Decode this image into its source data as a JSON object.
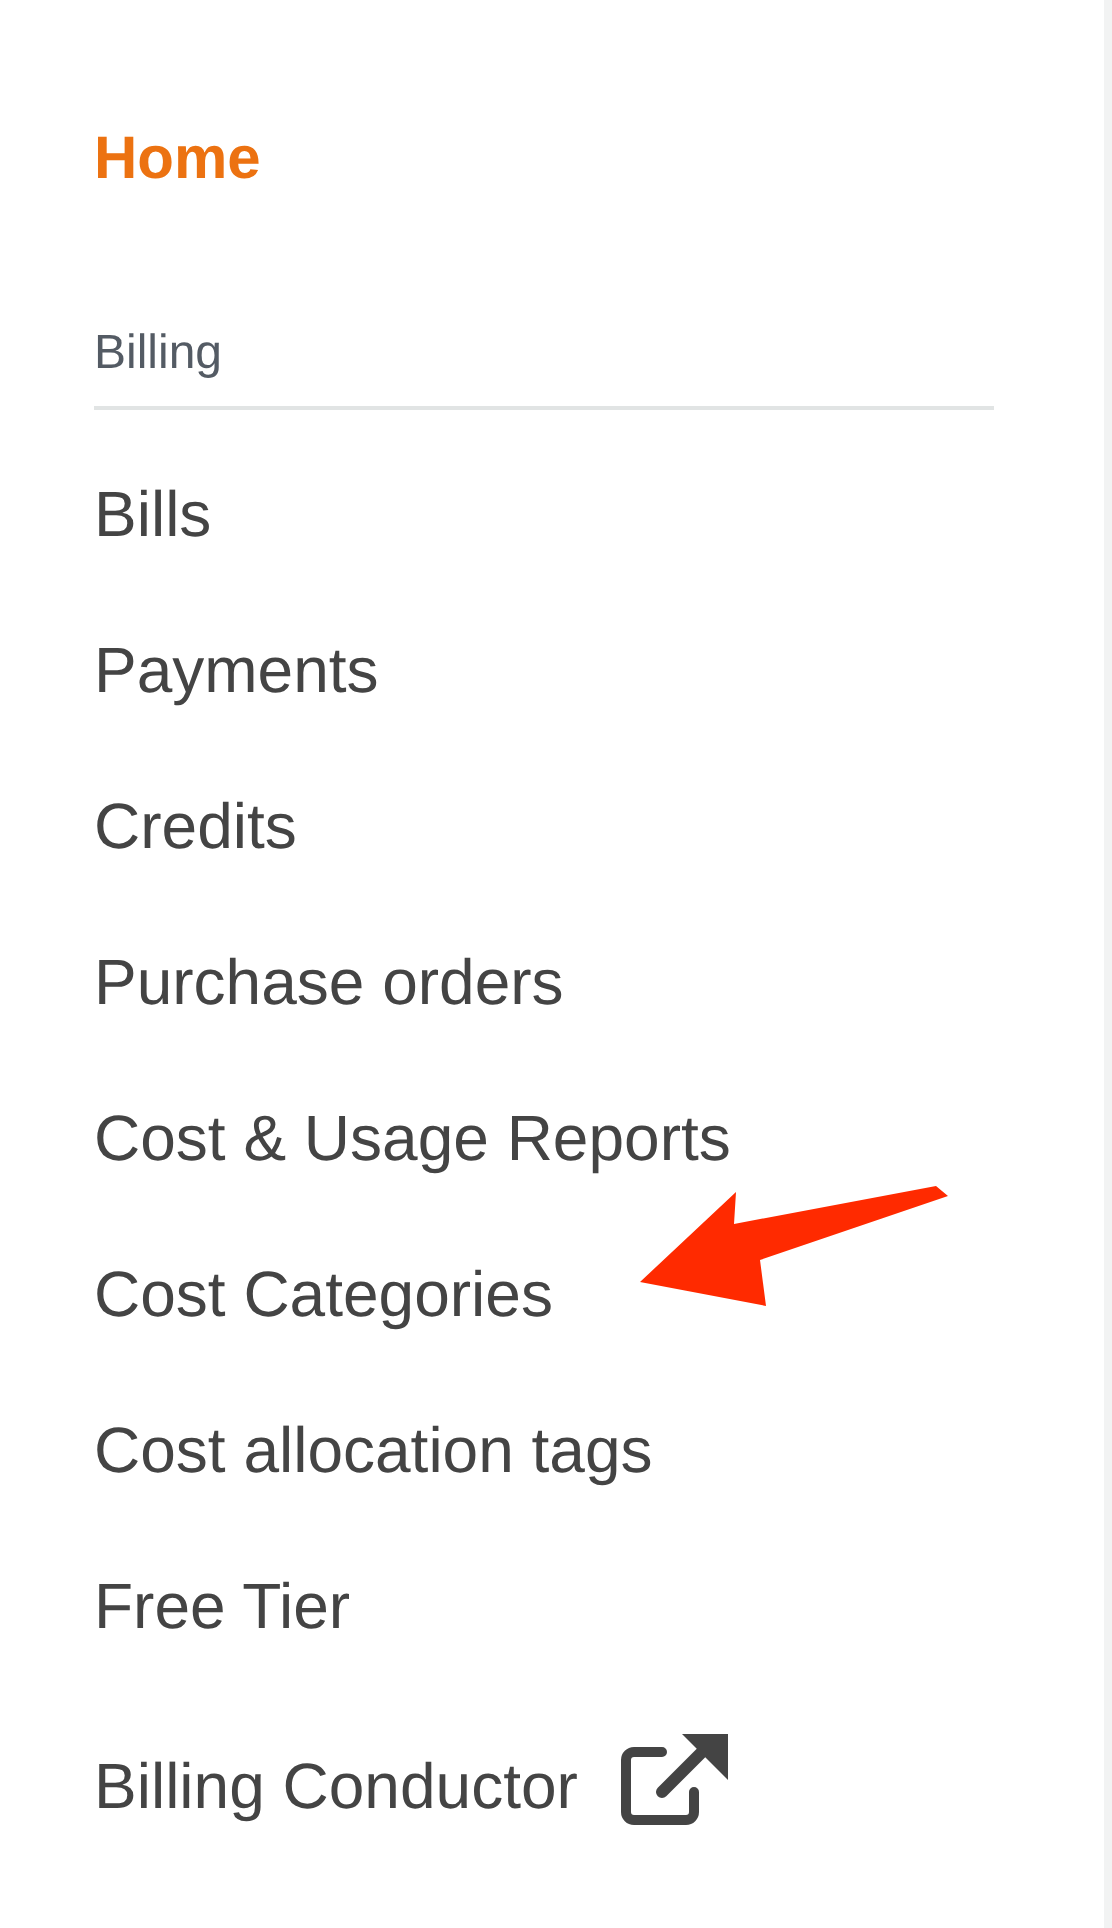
{
  "home": {
    "label": "Home",
    "selected": true
  },
  "section": {
    "title": "Billing"
  },
  "items": [
    {
      "label": "Bills",
      "selected": false
    },
    {
      "label": "Payments",
      "selected": false
    },
    {
      "label": "Credits",
      "selected": false
    },
    {
      "label": "Purchase orders",
      "selected": false
    },
    {
      "label": "Cost & Usage Reports",
      "selected": false
    },
    {
      "label": "Cost Categories",
      "selected": false,
      "highlighted": true
    },
    {
      "label": "Cost allocation tags",
      "selected": false
    },
    {
      "label": "Free Tier",
      "selected": false
    },
    {
      "label": "Billing Conductor",
      "selected": false,
      "external": true
    }
  ]
}
